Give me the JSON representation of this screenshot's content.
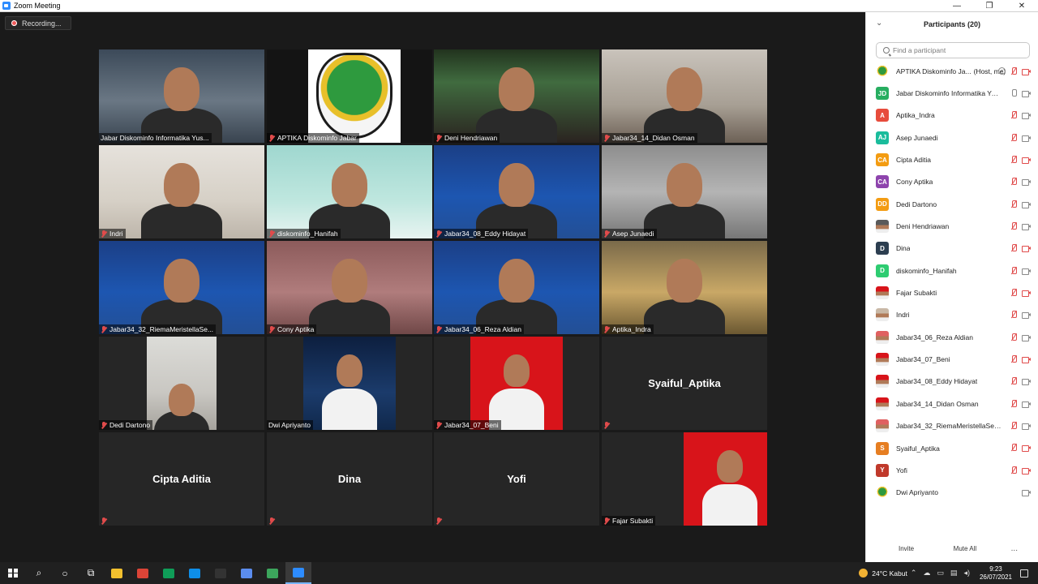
{
  "window": {
    "title": "Zoom Meeting",
    "controls": [
      "—",
      "❐",
      "✕"
    ]
  },
  "recording": {
    "label": "Recording..."
  },
  "gallery": [
    {
      "name": "Jabar Diskominfo Informatika Yus...",
      "muted": false,
      "video": "office"
    },
    {
      "name": "APTIKA Diskominfo Jabar",
      "muted": true,
      "video": "logo"
    },
    {
      "name": "Deni Hendriawan",
      "muted": true,
      "video": "aurora"
    },
    {
      "name": "Jabar34_14_Didan Osman",
      "muted": true,
      "video": "room"
    },
    {
      "name": "Indri",
      "muted": true,
      "video": "shelf"
    },
    {
      "name": "diskominfo_Hanifah",
      "muted": true,
      "video": "teal"
    },
    {
      "name": "Jabar34_08_Eddy Hidayat",
      "muted": true,
      "video": "cpns"
    },
    {
      "name": "Asep Junaedi",
      "muted": true,
      "video": "gray"
    },
    {
      "name": "Jabar34_32_RiemaMeristellaSe...",
      "muted": true,
      "video": "cpns"
    },
    {
      "name": "Cony Aptika",
      "muted": true,
      "video": "pink"
    },
    {
      "name": "Jabar34_06_Reza Aldian",
      "muted": true,
      "video": "cpns"
    },
    {
      "name": "Aptika_Indra",
      "muted": true,
      "video": "amber"
    },
    {
      "name": "Dedi Dartono",
      "muted": true,
      "video": "wall"
    },
    {
      "name": "Dwi Apriyanto",
      "muted": false,
      "video": "space"
    },
    {
      "name": "Jabar34_07_Beni",
      "muted": true,
      "video": "red"
    },
    {
      "name": "",
      "muted": true,
      "video": "none",
      "big_name": "Syaiful_Aptika"
    },
    {
      "name": "",
      "muted": true,
      "video": "none",
      "big_name": "Cipta Aditia"
    },
    {
      "name": "",
      "muted": true,
      "video": "none",
      "big_name": "Dina"
    },
    {
      "name": "",
      "muted": true,
      "video": "none",
      "big_name": "Yofi"
    },
    {
      "name": "Fajar Subakti",
      "muted": true,
      "video": "red"
    }
  ],
  "sidebar": {
    "title": "Participants (20)",
    "search_placeholder": "Find a participant",
    "participants": [
      {
        "initials": "",
        "name": "APTIKA Diskominfo Ja...",
        "role": "(Host, me)",
        "color": "#ffffff",
        "image": "logo",
        "mic": "muted",
        "cam": "off",
        "share": true
      },
      {
        "initials": "JD",
        "name": "Jabar Diskominfo Informatika Yus...",
        "role": "",
        "color": "#27ae60",
        "mic": "on",
        "cam": "on"
      },
      {
        "initials": "A",
        "name": "Aptika_Indra",
        "role": "",
        "color": "#e74c3c",
        "mic": "muted",
        "cam": "on"
      },
      {
        "initials": "AJ",
        "name": "Asep Junaedi",
        "role": "",
        "color": "#1abc9c",
        "mic": "muted",
        "cam": "on"
      },
      {
        "initials": "CA",
        "name": "Cipta Aditia",
        "role": "",
        "color": "#f39c12",
        "mic": "muted",
        "cam": "off"
      },
      {
        "initials": "CA",
        "name": "Cony Aptika",
        "role": "",
        "color": "#8e44ad",
        "mic": "muted",
        "cam": "on"
      },
      {
        "initials": "DD",
        "name": "Dedi Dartono",
        "role": "",
        "color": "#f39c12",
        "mic": "muted",
        "cam": "on"
      },
      {
        "initials": "",
        "name": "Deni Hendriawan",
        "role": "",
        "color": "#5a5a5a",
        "image": "photo",
        "mic": "muted",
        "cam": "on"
      },
      {
        "initials": "D",
        "name": "Dina",
        "role": "",
        "color": "#2c3e50",
        "mic": "muted",
        "cam": "off"
      },
      {
        "initials": "D",
        "name": "diskominfo_Hanifah",
        "role": "",
        "color": "#2ecc71",
        "mic": "muted",
        "cam": "on"
      },
      {
        "initials": "",
        "name": "Fajar Subakti",
        "role": "",
        "color": "#d8141a",
        "image": "photo",
        "mic": "muted",
        "cam": "off"
      },
      {
        "initials": "",
        "name": "Indri",
        "role": "",
        "color": "#c9b8a6",
        "image": "photo",
        "mic": "muted",
        "cam": "on"
      },
      {
        "initials": "",
        "name": "Jabar34_06_Reza Aldian",
        "role": "",
        "color": "#e06060",
        "image": "photo",
        "mic": "muted",
        "cam": "on"
      },
      {
        "initials": "",
        "name": "Jabar34_07_Beni",
        "role": "",
        "color": "#d8141a",
        "image": "photo",
        "mic": "muted",
        "cam": "off"
      },
      {
        "initials": "",
        "name": "Jabar34_08_Eddy Hidayat",
        "role": "",
        "color": "#d8141a",
        "image": "photo",
        "mic": "muted",
        "cam": "on"
      },
      {
        "initials": "",
        "name": "Jabar34_14_Didan Osman",
        "role": "",
        "color": "#d8141a",
        "image": "photo",
        "mic": "muted",
        "cam": "on"
      },
      {
        "initials": "",
        "name": "Jabar34_32_RiemaMeristellaSetya...",
        "role": "",
        "color": "#e06060",
        "image": "photo",
        "mic": "muted",
        "cam": "on"
      },
      {
        "initials": "S",
        "name": "Syaiful_Aptika",
        "role": "",
        "color": "#e67e22",
        "mic": "muted",
        "cam": "off"
      },
      {
        "initials": "Y",
        "name": "Yofi",
        "role": "",
        "color": "#c0392b",
        "mic": "muted",
        "cam": "off"
      },
      {
        "initials": "",
        "name": "Dwi Apriyanto",
        "role": "",
        "color": "#ffffff",
        "image": "logo",
        "mic": "none",
        "cam": "on"
      }
    ],
    "invite_label": "Invite",
    "mute_all_label": "Mute All",
    "more_label": "..."
  },
  "taskbar": {
    "apps": [
      {
        "name": "file-explorer",
        "color": "#f2c02e"
      },
      {
        "name": "chrome",
        "color": "#db4437"
      },
      {
        "name": "chrome-2",
        "color": "#0f9d58"
      },
      {
        "name": "teamviewer",
        "color": "#0e8ee9"
      },
      {
        "name": "terminal",
        "color": "#333333"
      },
      {
        "name": "network-tool",
        "color": "#5b8def"
      },
      {
        "name": "app-green",
        "color": "#3ca55c"
      },
      {
        "name": "zoom",
        "color": "#2d8cff"
      }
    ],
    "weather": "24°C  Kabut",
    "time": "9:23",
    "date": "26/07/2021"
  }
}
